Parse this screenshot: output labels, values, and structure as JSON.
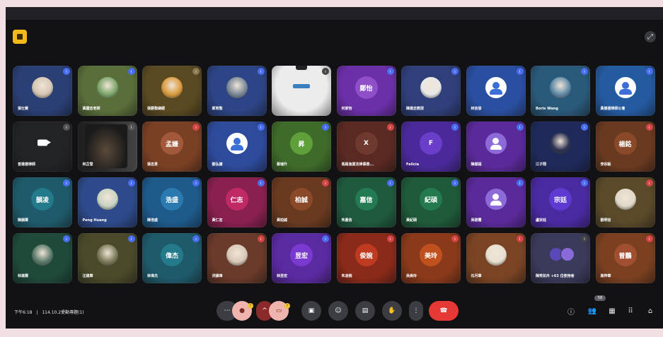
{
  "meeting": {
    "time": "下午6:18",
    "separator": "|",
    "title": "114.10.2愛動專題(1)",
    "participant_count": "58"
  },
  "colors": {
    "leave_red": "#e53935",
    "badge_blue": "#4a6ef0",
    "badge_red": "#d64545"
  },
  "tiles": [
    {
      "name": "張仕賢",
      "bg": "#2a3f74",
      "avatar": "photo",
      "avbg": "#d5c6b4",
      "badge": "#4a6ef0"
    },
    {
      "name": "黃國志老師",
      "bg": "#5a6e3a",
      "avatar": "photo",
      "avbg": "#7ca66a",
      "badge": "#4a6ef0"
    },
    {
      "name": "張勝聖總經",
      "bg": "#5a4a22",
      "avatar": "photo",
      "avbg": "#d99a3c",
      "badge": "#8a7a50"
    },
    {
      "name": "郭育聖",
      "bg": "#2d4586",
      "avatar": "photo",
      "avbg": "#7a8898",
      "badge": "#4a6ef0"
    },
    {
      "name": "",
      "bg": "#ececec",
      "avatar": "screen",
      "avbg": "#ffffff",
      "badge": "#444"
    },
    {
      "name": "何家怡",
      "bg": "#6b2fa8",
      "avatar": "text",
      "avtxt": "鄭怡",
      "avbg": "#8e4fc7",
      "badge": "#4a6ef0"
    },
    {
      "name": "陳建志教授",
      "bg": "#2f3f7a",
      "avatar": "photo",
      "avbg": "#e8e8e8",
      "badge": "#4a6ef0"
    },
    {
      "name": "林信發",
      "bg": "#2a4fa0",
      "avatar": "generic",
      "badge": "#4a6ef0"
    },
    {
      "name": "Boris Wang",
      "bg": "#2a5a7a",
      "avatar": "photo",
      "avbg": "#5f8aa8",
      "badge": "#4a6ef0"
    },
    {
      "name": "黃建德律師公會",
      "bg": "#245aa0",
      "avatar": "generic",
      "badge": "#4a6ef0"
    },
    {
      "name": "曾建德律師",
      "bg": "#222325",
      "avatar": "cam",
      "badge": "#555"
    },
    {
      "name": "林芷瑩",
      "bg": "#1a1a1a",
      "avatar": "video",
      "badge": "#555"
    },
    {
      "name": "張志勇",
      "bg": "#7a4024",
      "avatar": "text",
      "avtxt": "孟謙",
      "avbg": "#a2583a",
      "badge": "#d64545"
    },
    {
      "name": "劉弘謙",
      "bg": "#2e4a9a",
      "avatar": "generic",
      "badge": "#4a6ef0"
    },
    {
      "name": "蔡瑞升",
      "bg": "#3f6b2a",
      "avatar": "text",
      "avtxt": "昇",
      "avbg": "#5fa03a",
      "badge": "#4a6ef0"
    },
    {
      "name": "馬路漁業法律事務...",
      "bg": "#5a2a22",
      "avatar": "text",
      "avtxt": "X",
      "avbg": "#6e3a30",
      "badge": "#d64545"
    },
    {
      "name": "Felicia",
      "bg": "#4a2a9a",
      "avatar": "text",
      "avtxt": "F",
      "avbg": "#6a3ec8",
      "badge": "#4a6ef0"
    },
    {
      "name": "陳順福",
      "bg": "#5a2a9a",
      "avatar": "purple",
      "badge": "#4a6ef0"
    },
    {
      "name": "江子翔",
      "bg": "#1f2a5a",
      "avatar": "photo",
      "avbg": "#2a3050",
      "badge": "#4a6ef0"
    },
    {
      "name": "李宗毅",
      "bg": "#6a3a20",
      "avatar": "text",
      "avtxt": "楊銘",
      "avbg": "#8a4a2a",
      "badge": "#d64545"
    },
    {
      "name": "陳韻菁",
      "bg": "#1f5a6a",
      "avatar": "text",
      "avtxt": "韻凌",
      "avbg": "#237a8a",
      "badge": "#4a6ef0"
    },
    {
      "name": "Peng Huang",
      "bg": "#2e4a8a",
      "avatar": "photo",
      "avbg": "#c9d4c2",
      "badge": "#4a6ef0"
    },
    {
      "name": "陳浩盛",
      "bg": "#1e5a8a",
      "avatar": "text",
      "avtxt": "浩盛",
      "avbg": "#2a7ab0",
      "badge": "#4a6ef0"
    },
    {
      "name": "黃仁志",
      "bg": "#8a2050",
      "avatar": "text",
      "avtxt": "仁志",
      "avbg": "#c02a64",
      "badge": "#4a6ef0"
    },
    {
      "name": "黃柏誠",
      "bg": "#6a3a20",
      "avatar": "text",
      "avtxt": "柏誠",
      "avbg": "#8a4a2a",
      "badge": "#d64545"
    },
    {
      "name": "朱嘉信",
      "bg": "#1f5a3e",
      "avatar": "text",
      "avtxt": "嘉信",
      "avbg": "#247a52",
      "badge": "#4a6ef0"
    },
    {
      "name": "黃紀碩",
      "bg": "#1f5a3a",
      "avatar": "text",
      "avtxt": "紀碩",
      "avbg": "#247a4e",
      "badge": "#4a6ef0"
    },
    {
      "name": "吳碧霞",
      "bg": "#5a2a9a",
      "avatar": "purple",
      "badge": "#4a6ef0"
    },
    {
      "name": "盧宗廷",
      "bg": "#4a2aa0",
      "avatar": "text",
      "avtxt": "宗廷",
      "avbg": "#5e3ad0",
      "badge": "#4a6ef0"
    },
    {
      "name": "劉明信",
      "bg": "#5a4a2a",
      "avatar": "photo",
      "avbg": "#e0d8c8",
      "badge": "#d64545"
    },
    {
      "name": "林建霖",
      "bg": "#1f4a3a",
      "avatar": "photo",
      "avbg": "#5a7a6a",
      "badge": "#4a6ef0"
    },
    {
      "name": "汪建華",
      "bg": "#4a4a2a",
      "avatar": "photo",
      "avbg": "#7a7a5a",
      "badge": "#4a6ef0"
    },
    {
      "name": "林偉杰",
      "bg": "#1f5a6a",
      "avatar": "text",
      "avtxt": "偉杰",
      "avbg": "#247a8a",
      "badge": "#4a6ef0"
    },
    {
      "name": "洪韻瑋",
      "bg": "#6a3a2a",
      "avatar": "photo",
      "avbg": "#d8c8b8",
      "badge": "#d64545"
    },
    {
      "name": "林昱宏",
      "bg": "#5a2aa0",
      "avatar": "text",
      "avtxt": "昱宏",
      "avbg": "#7a3ad0",
      "badge": "#4a6ef0"
    },
    {
      "name": "朱凌婉",
      "bg": "#8a2a1a",
      "avatar": "text",
      "avtxt": "俊婉",
      "avbg": "#c03a22",
      "badge": "#d64545"
    },
    {
      "name": "吳美玲",
      "bg": "#8a3a1a",
      "avatar": "text",
      "avtxt": "美玲",
      "avbg": "#c0501e",
      "badge": "#d64545"
    },
    {
      "name": "石月華",
      "bg": "#7a4424",
      "avatar": "photo",
      "avbg": "#e8e0d0",
      "badge": "#d64545"
    },
    {
      "name": "陳秀如卉 +63 位使用者",
      "bg": "#3a3a5a",
      "avatar": "group",
      "avbg": "#6a5ac8",
      "badge": "#444"
    },
    {
      "name": "高梓華",
      "bg": "#7a4020",
      "avatar": "text",
      "avtxt": "曾鵬",
      "avbg": "#a05030",
      "badge": "#d64545"
    }
  ]
}
